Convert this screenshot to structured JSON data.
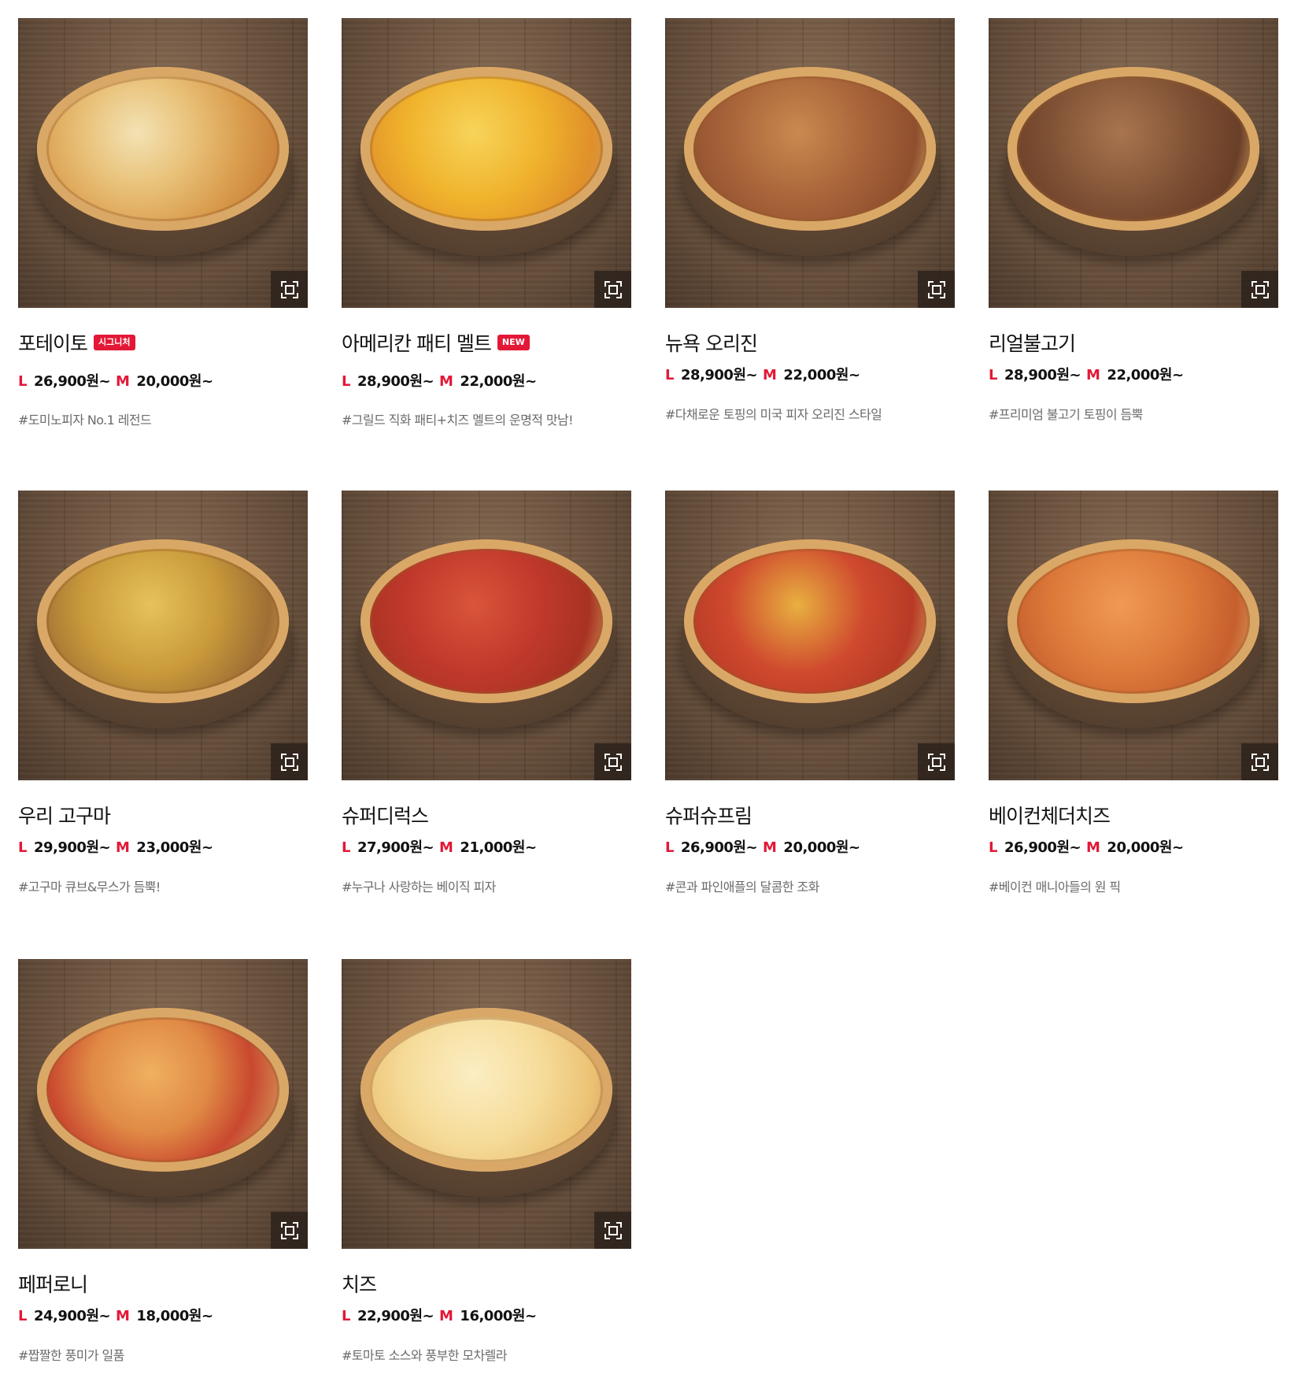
{
  "products": [
    {
      "name": "포테이토",
      "badge": "시그니처",
      "size_l": "L",
      "price_l": "26,900원~",
      "size_m": "M",
      "price_m": "20,000원~",
      "desc": "#도미노피자 No.1 레전드",
      "image_icon": "potato-pizza-image"
    },
    {
      "name": "아메리칸 패티 멜트",
      "badge": "NEW",
      "size_l": "L",
      "price_l": "28,900원~",
      "size_m": "M",
      "price_m": "22,000원~",
      "desc": "#그릴드 직화 패티+치즈 멜트의 운명적 맛남!",
      "image_icon": "patty-melt-pizza-image"
    },
    {
      "name": "뉴욕 오리진",
      "badge": "",
      "size_l": "L",
      "price_l": "28,900원~",
      "size_m": "M",
      "price_m": "22,000원~",
      "desc": "#다채로운 토핑의 미국 피자 오리진 스타일",
      "image_icon": "ny-origin-pizza-image"
    },
    {
      "name": "리얼불고기",
      "badge": "",
      "size_l": "L",
      "price_l": "28,900원~",
      "size_m": "M",
      "price_m": "22,000원~",
      "desc": "#프리미엄 불고기 토핑이 듬뿍",
      "image_icon": "bulgogi-pizza-image"
    },
    {
      "name": "우리 고구마",
      "badge": "",
      "size_l": "L",
      "price_l": "29,900원~",
      "size_m": "M",
      "price_m": "23,000원~",
      "desc": "#고구마 큐브&무스가 듬뿍!",
      "image_icon": "sweet-potato-pizza-image"
    },
    {
      "name": "슈퍼디럭스",
      "badge": "",
      "size_l": "L",
      "price_l": "27,900원~",
      "size_m": "M",
      "price_m": "21,000원~",
      "desc": "#누구나 사랑하는 베이직 피자",
      "image_icon": "super-deluxe-pizza-image"
    },
    {
      "name": "슈퍼슈프림",
      "badge": "",
      "size_l": "L",
      "price_l": "26,900원~",
      "size_m": "M",
      "price_m": "20,000원~",
      "desc": "#콘과 파인애플의 달콤한 조화",
      "image_icon": "super-supreme-pizza-image"
    },
    {
      "name": "베이컨체더치즈",
      "badge": "",
      "size_l": "L",
      "price_l": "26,900원~",
      "size_m": "M",
      "price_m": "20,000원~",
      "desc": "#베이컨 매니아들의 원 픽",
      "image_icon": "bacon-cheddar-pizza-image"
    },
    {
      "name": "페퍼로니",
      "badge": "",
      "size_l": "L",
      "price_l": "24,900원~",
      "size_m": "M",
      "price_m": "18,000원~",
      "desc": "#짭짤한 풍미가 일품",
      "image_icon": "pepperoni-pizza-image"
    },
    {
      "name": "치즈",
      "badge": "",
      "size_l": "L",
      "price_l": "22,900원~",
      "size_m": "M",
      "price_m": "16,000원~",
      "desc": "#토마토 소스와 풍부한 모차렐라",
      "image_icon": "cheese-pizza-image"
    }
  ],
  "zoom_icon": "zoom-expand-icon",
  "colors": {
    "accent": "#e31837",
    "text": "#111111",
    "muted": "#6b6b6b",
    "wood": "#6a513d"
  }
}
